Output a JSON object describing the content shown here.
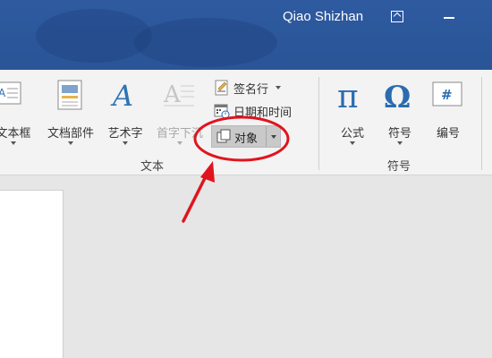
{
  "titlebar": {
    "user_name": "Qiao Shizhan"
  },
  "ribbon": {
    "text_group": {
      "buttons": {
        "text_box": "文本框",
        "quick_parts": "文档部件",
        "wordart": "艺术字",
        "drop_cap": "首字下沉"
      },
      "signature_line": "签名行",
      "date_time": "日期和时间",
      "object": "对象",
      "group_label": "文本"
    },
    "symbols_group": {
      "buttons": {
        "equation": "公式",
        "symbol": "符号",
        "number": "编号"
      },
      "group_label": "符号"
    }
  },
  "colors": {
    "title_bar": "#2b579a",
    "annotation": "#e0141e",
    "icon_blue": "#2b6cb0"
  },
  "icons": [
    "ribbon-display-options-icon",
    "minimize-icon",
    "pi-icon",
    "omega-icon",
    "hash-icon"
  ]
}
